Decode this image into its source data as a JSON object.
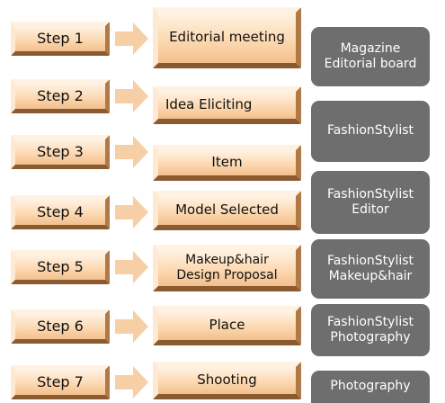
{
  "colors": {
    "box_light": "#fff3e4",
    "box_mid": "#fcd9b2",
    "box_dark": "#f3bf8c",
    "arrow": "#f7cfa6",
    "role_bg": "#6e6e6e",
    "role_text": "#ffffff"
  },
  "steps": [
    {
      "label": "Step 1",
      "activity": [
        "Editorial meeting"
      ],
      "role": [
        "Magazine",
        "Editorial board"
      ]
    },
    {
      "label": "Step 2",
      "activity": [
        "Idea Eliciting"
      ],
      "role": [
        "FashionStylist"
      ]
    },
    {
      "label": "Step 3",
      "activity": [
        "Item"
      ],
      "role": []
    },
    {
      "label": "Step 4",
      "activity": [
        "Model Selected"
      ],
      "role": [
        "FashionStylist",
        "Editor"
      ]
    },
    {
      "label": "Step 5",
      "activity": [
        "Makeup&hair",
        "Design Proposal"
      ],
      "role": [
        "FashionStylist",
        "Makeup&hair"
      ]
    },
    {
      "label": "Step 6",
      "activity": [
        "Place"
      ],
      "role": [
        "FashionStylist",
        "Photography"
      ]
    },
    {
      "label": "Step 7",
      "activity": [
        "Shooting"
      ],
      "role": [
        "Photography"
      ]
    }
  ]
}
